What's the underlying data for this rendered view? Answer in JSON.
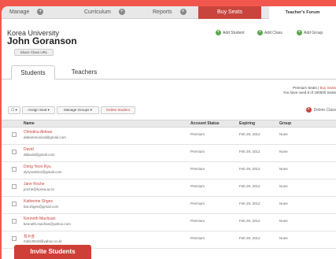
{
  "nav": {
    "tabs": [
      {
        "label": "Manage"
      },
      {
        "label": "Curriculum"
      },
      {
        "label": "Reports"
      }
    ],
    "buy_label": "Buy Seats",
    "forum_label": "Teacher's Forum"
  },
  "header": {
    "org": "Korea University",
    "user": "John Goranson",
    "class_url_button": "Share Class URL",
    "actions": [
      "Add Student",
      "Add Class",
      "Add Group"
    ]
  },
  "tabs": [
    {
      "label": "Students"
    },
    {
      "label": "Teachers"
    }
  ],
  "premium": {
    "line1_prefix": "Premium Seats | ",
    "line1_link": "Buy Seats",
    "line2": "You have used 8 of 150000 Seats"
  },
  "toolbar": {
    "select_label": "☐ ▾",
    "assign_label": "Assign Seat ▾",
    "groups_label": "Manage Groups ▾",
    "delete_label": "Delete Student",
    "delete_class_label": "Delete Class"
  },
  "table": {
    "columns": [
      "Name",
      "Account Status",
      "Expiring",
      "Group"
    ],
    "rows": [
      {
        "name": "Christina Aldean",
        "email": "aldeanmusical@gmail.com",
        "status": "Premium",
        "expiring": "Feb 29, 2012",
        "group": "None"
      },
      {
        "name": "David",
        "email": "dtdavid@gmail.com",
        "status": "Premium",
        "expiring": "Feb 29, 2012",
        "group": "None"
      },
      {
        "name": "Dong Yeon Ryu",
        "email": "dyryou0312@gmail.com",
        "status": "Premium",
        "expiring": "Feb 29, 2012",
        "group": "None"
      },
      {
        "name": "Jane Roche",
        "email": "jroche@korea.ac.kr",
        "status": "Premium",
        "expiring": "Feb 29, 2012",
        "group": "None"
      },
      {
        "name": "Katherine Shges",
        "email": "kat.shges@gmail.com",
        "status": "Premium",
        "expiring": "Feb 29, 2012",
        "group": "None"
      },
      {
        "name": "Kenneth Machuan",
        "email": "kenneth.machan@yahoo.com",
        "status": "Premium",
        "expiring": "Feb 29, 2012",
        "group": "None"
      },
      {
        "name": "최수영",
        "email": "mdsc0618@yahoo.co.kr",
        "status": "Premium",
        "expiring": "Feb 29, 2012",
        "group": "None"
      }
    ]
  },
  "invite_label": "Invite Students"
}
